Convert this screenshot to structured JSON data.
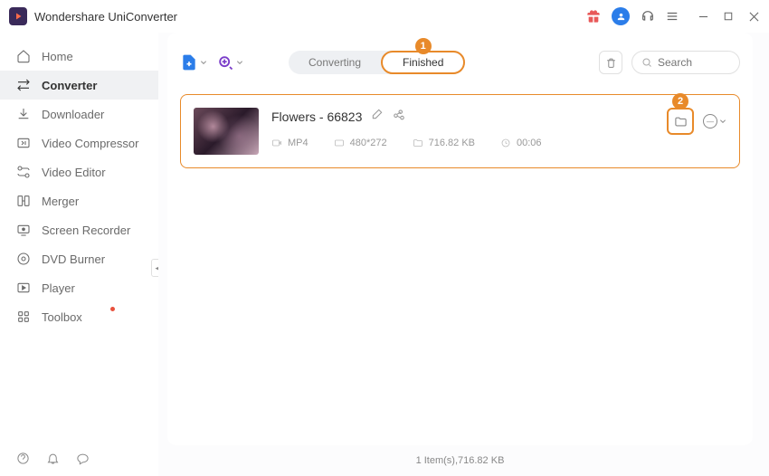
{
  "app": {
    "title": "Wondershare UniConverter"
  },
  "sidebar": {
    "items": [
      {
        "label": "Home"
      },
      {
        "label": "Converter"
      },
      {
        "label": "Downloader"
      },
      {
        "label": "Video Compressor"
      },
      {
        "label": "Video Editor"
      },
      {
        "label": "Merger"
      },
      {
        "label": "Screen Recorder"
      },
      {
        "label": "DVD Burner"
      },
      {
        "label": "Player"
      },
      {
        "label": "Toolbox"
      }
    ]
  },
  "tabs": {
    "converting": "Converting",
    "finished": "Finished"
  },
  "search": {
    "placeholder": "Search"
  },
  "callouts": {
    "one": "1",
    "two": "2"
  },
  "file": {
    "title": "Flowers - 66823",
    "format": "MP4",
    "resolution": "480*272",
    "size": "716.82 KB",
    "duration": "00:06"
  },
  "status": {
    "summary": "1 Item(s),716.82 KB"
  },
  "colors": {
    "accent": "#e88a2a",
    "primary": "#2b7de9"
  }
}
